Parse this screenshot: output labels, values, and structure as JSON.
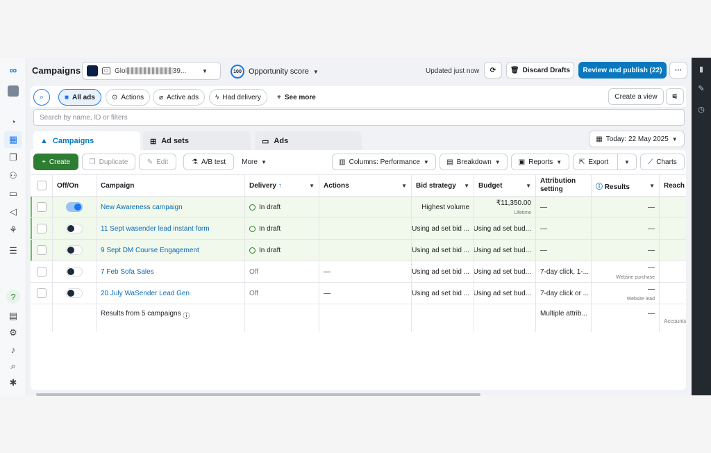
{
  "header": {
    "title": "Campaigns",
    "account_name": "Glol",
    "account_suffix": "39...",
    "opportunity_score_value": "100",
    "opportunity_score_label": "Opportunity score",
    "updated_text": "Updated just now",
    "discard_label": "Discard Drafts",
    "publish_label": "Review and publish (22)",
    "more_label": "···"
  },
  "filters": {
    "all_ads": "All ads",
    "actions": "Actions",
    "active_ads": "Active ads",
    "had_delivery": "Had delivery",
    "see_more": "See more",
    "create_view": "Create a view"
  },
  "search": {
    "placeholder": "Search by name, ID or filters"
  },
  "tabs": {
    "campaigns": "Campaigns",
    "ad_sets": "Ad sets",
    "ads": "Ads"
  },
  "date_range": "Today: 22 May 2025",
  "toolbar": {
    "create": "Create",
    "duplicate": "Duplicate",
    "edit": "Edit",
    "ab_test": "A/B test",
    "more": "More",
    "columns": "Columns: Performance",
    "breakdown": "Breakdown",
    "reports": "Reports",
    "export": "Export",
    "charts": "Charts"
  },
  "table": {
    "headers": {
      "offon": "Off/On",
      "campaign": "Campaign",
      "delivery": "Delivery",
      "actions": "Actions",
      "bid": "Bid strategy",
      "budget": "Budget",
      "attribution": "Attribution setting",
      "results": "Results",
      "reach": "Reach"
    },
    "rows": [
      {
        "campaign": "New Awareness campaign",
        "delivery": "In draft",
        "actions": "",
        "bid": "Highest volume",
        "budget": "₹11,350.00",
        "budget_sub": "Lifetime",
        "attribution": "—",
        "results": "—",
        "results_sub": "",
        "on": true
      },
      {
        "campaign": "11 Sept wasender lead instant form",
        "delivery": "In draft",
        "actions": "",
        "bid": "Using ad set bid ...",
        "budget": "Using ad set bud...",
        "budget_sub": "",
        "attribution": "—",
        "results": "—",
        "results_sub": "",
        "on": false
      },
      {
        "campaign": "9 Sept DM Course Engagement",
        "delivery": "In draft",
        "actions": "",
        "bid": "Using ad set bid ...",
        "budget": "Using ad set bud...",
        "budget_sub": "",
        "attribution": "—",
        "results": "—",
        "results_sub": "",
        "on": false
      },
      {
        "campaign": "7 Feb Sofa Sales",
        "delivery": "Off",
        "actions": "—",
        "bid": "Using ad set bid ...",
        "budget": "Using ad set bud...",
        "budget_sub": "",
        "attribution": "7-day click, 1-...",
        "results": "—",
        "results_sub": "Website purchase",
        "on": false
      },
      {
        "campaign": "20 July WaSender Lead Gen",
        "delivery": "Off",
        "actions": "—",
        "bid": "Using ad set bid ...",
        "budget": "Using ad set bud...",
        "budget_sub": "",
        "attribution": "7-day click or ...",
        "results": "—",
        "results_sub": "Website lead",
        "on": false
      }
    ],
    "summary": {
      "label": "Results from 5 campaigns",
      "attribution": "Multiple attrib...",
      "results": "—",
      "reach_sub": "Accounts"
    }
  }
}
